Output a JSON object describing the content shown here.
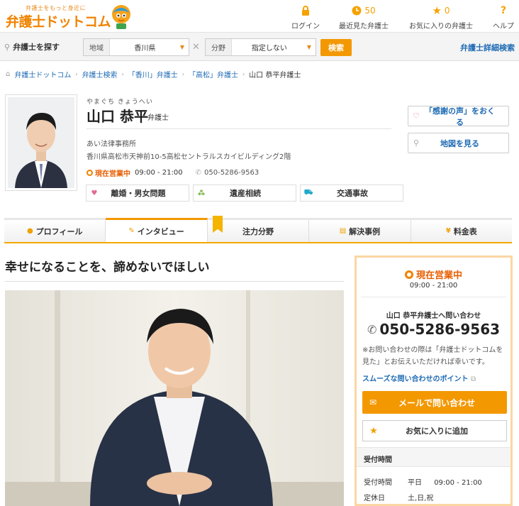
{
  "header": {
    "tagline": "弁護士をもっと身近に",
    "brand": "弁護士ドットコム",
    "nav": [
      {
        "icon": "lock-icon",
        "value": "",
        "label": "ログイン"
      },
      {
        "icon": "clock-icon",
        "value": "50",
        "label": "最近見た弁護士"
      },
      {
        "icon": "star-icon",
        "value": "0",
        "label": "お気に入りの弁護士"
      },
      {
        "icon": "help-icon",
        "value": "?",
        "label": "ヘルプ"
      }
    ]
  },
  "search": {
    "label": "弁護士を探す",
    "region_key": "地域",
    "region_value": "香川県",
    "field_key": "分野",
    "field_value": "指定しない",
    "button": "検索",
    "advanced": "弁護士詳細検索"
  },
  "breadcrumb": [
    "弁護士ドットコム",
    "弁護士検索",
    "「香川」弁護士",
    "「高松」弁護士",
    "山口 恭平弁護士"
  ],
  "profile": {
    "kana": "やまぐち きょうへい",
    "name": "山口 恭平",
    "suffix": "弁護士",
    "office": "あい法律事務所",
    "address": "香川県高松市天神前10-5高松セントラルスカイビルディング2階",
    "status": "現在営業中",
    "hours": "09:00 - 21:00",
    "phone": "050-5286-9563",
    "tags": [
      "離婚・男女問題",
      "遺産相続",
      "交通事故"
    ]
  },
  "side_buttons": {
    "thanks": "「感謝の声」をおくる",
    "map": "地図を見る"
  },
  "tabs": [
    "プロフィール",
    "インタビュー",
    "注力分野",
    "解決事例",
    "料金表"
  ],
  "article": {
    "headline": "幸せになることを、諦めないでほしい"
  },
  "card": {
    "status": "現在営業中",
    "hours": "09:00 - 21:00",
    "inquiry": "山口 恭平弁護士へ問い合わせ",
    "phone": "050-5286-9563",
    "note": "※お問い合わせの際は「弁護士ドットコムを見た」とお伝えいただければ幸いです。",
    "tip": "スムーズな問い合わせのポイント",
    "mail": "メールで問い合わせ",
    "favorite": "お気に入りに追加",
    "reception_header": "受付時間",
    "reception_key": "受付時間",
    "reception_day": "平日",
    "reception_hours": "09:00 - 21:00",
    "closed_key": "定休日",
    "closed_value": "土,日,祝"
  },
  "colors": {
    "accent": "#f39800",
    "link": "#1e6ab4",
    "status": "#e85d00"
  }
}
